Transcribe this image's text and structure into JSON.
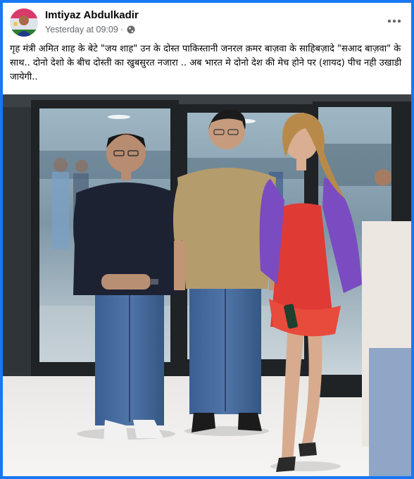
{
  "post": {
    "author": "Imtiyaz Abdulkadir",
    "timestamp": "Yesterday at 09:09",
    "separator": "·",
    "audience_icon": "globe-icon",
    "more_icon": "more-options-icon",
    "text": "गृह मंत्री अमित शाह के बेटे \"जय शाह\"  उन के दोस्त पाकिस्तानी जनरल क़मर बाज़वा के साहिबज़ादे \"सआद बाज़वा\" के साथ.. दोनो देशो के बीच दोस्ती का खुबसुरत नजारा .. अब भारत मे दोनो देश की मेच होने पर (शायद) पीच नही उखाडी जायेगी.."
  },
  "colors": {
    "frame": "#1877f2",
    "card": "#ffffff",
    "name_text": "#050505",
    "meta_text": "#65676b"
  }
}
